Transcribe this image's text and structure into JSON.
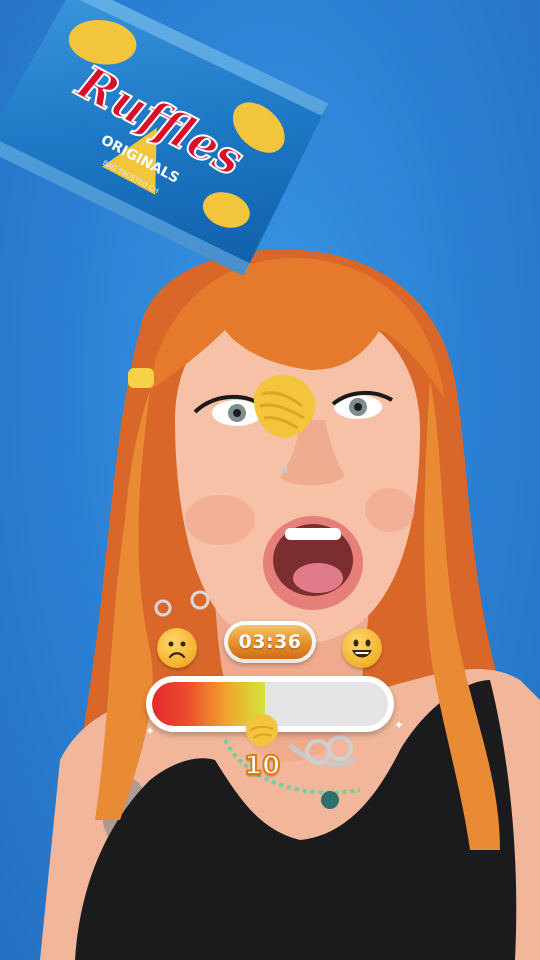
{
  "chip_bag": {
    "brand": "Ruffles",
    "variant": "ORIGINALS",
    "fine_print": "BAG TRUSTED CH"
  },
  "hud": {
    "timer": "03:36",
    "score": "10",
    "meter_level_percent": 48,
    "left_emoji": "sad-face-icon",
    "right_emoji": "happy-face-icon"
  },
  "colors": {
    "background": "#2f86d8",
    "bag_blue": "#1e79c6",
    "logo_red": "#d8102a",
    "chip_yellow": "#f3c53c",
    "hair": "#e2742b",
    "timer_orange": "#e48f2a",
    "meter_red": "#e42a2a",
    "meter_green": "#d4e63a"
  }
}
